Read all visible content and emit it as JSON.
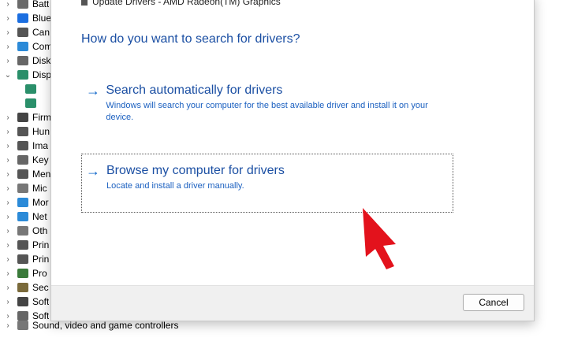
{
  "device_tree": {
    "rows": [
      {
        "label": "Batt",
        "icon": "battery-icon",
        "color": "#6a6a6a",
        "expanded": false
      },
      {
        "label": "Blue",
        "icon": "bluetooth-icon",
        "color": "#1b6ee0",
        "expanded": false
      },
      {
        "label": "Can",
        "icon": "camera-icon",
        "color": "#555555",
        "expanded": false
      },
      {
        "label": "Com",
        "icon": "computer-icon",
        "color": "#2b8ad8",
        "expanded": false
      },
      {
        "label": "Disk",
        "icon": "disk-drive-icon",
        "color": "#666666",
        "expanded": false
      },
      {
        "label": "Disp",
        "icon": "display-adapter-icon",
        "color": "#2a8f6a",
        "expanded": true
      },
      {
        "label": "",
        "icon": "display-adapter-child-icon",
        "color": "#2a8f6a",
        "expanded": null
      },
      {
        "label": "",
        "icon": "display-adapter-child-icon",
        "color": "#2a8f6a",
        "expanded": null
      },
      {
        "label": "Firm",
        "icon": "firmware-icon",
        "color": "#444444",
        "expanded": false
      },
      {
        "label": "Hun",
        "icon": "hid-icon",
        "color": "#555555",
        "expanded": false
      },
      {
        "label": "Ima",
        "icon": "imaging-icon",
        "color": "#555555",
        "expanded": false
      },
      {
        "label": "Key",
        "icon": "keyboard-icon",
        "color": "#666666",
        "expanded": false
      },
      {
        "label": "Men",
        "icon": "memory-icon",
        "color": "#555555",
        "expanded": false
      },
      {
        "label": "Mic",
        "icon": "mouse-icon",
        "color": "#777777",
        "expanded": false
      },
      {
        "label": "Mor",
        "icon": "monitor-icon",
        "color": "#2b8ad8",
        "expanded": false
      },
      {
        "label": "Net",
        "icon": "network-icon",
        "color": "#2b8ad8",
        "expanded": false
      },
      {
        "label": "Oth",
        "icon": "other-devices-icon",
        "color": "#777777",
        "expanded": false
      },
      {
        "label": "Prin",
        "icon": "printer-icon",
        "color": "#555555",
        "expanded": false
      },
      {
        "label": "Prin",
        "icon": "print-queue-icon",
        "color": "#555555",
        "expanded": false
      },
      {
        "label": "Pro",
        "icon": "processor-icon",
        "color": "#3a7a3a",
        "expanded": false
      },
      {
        "label": "Sec",
        "icon": "security-icon",
        "color": "#7a6a3a",
        "expanded": false
      },
      {
        "label": "Soft",
        "icon": "software-component-icon",
        "color": "#444444",
        "expanded": false
      },
      {
        "label": "Soft",
        "icon": "software-device-icon",
        "color": "#666666",
        "expanded": false
      }
    ],
    "bottom_row": "Sound, video and game controllers"
  },
  "dialog": {
    "title": "Update Drivers - AMD Radeon(TM) Graphics",
    "heading": "How do you want to search for drivers?",
    "options": [
      {
        "icon": "arrow-right-icon",
        "title": "Search automatically for drivers",
        "description": "Windows will search your computer for the best available driver and install it on your device."
      },
      {
        "icon": "arrow-right-icon",
        "title": "Browse my computer for drivers",
        "description": "Locate and install a driver manually."
      }
    ],
    "cancel_label": "Cancel"
  },
  "colors": {
    "heading": "#1b4fa3",
    "link_arrow": "#0a63c9",
    "pointer": "#e3121c"
  }
}
